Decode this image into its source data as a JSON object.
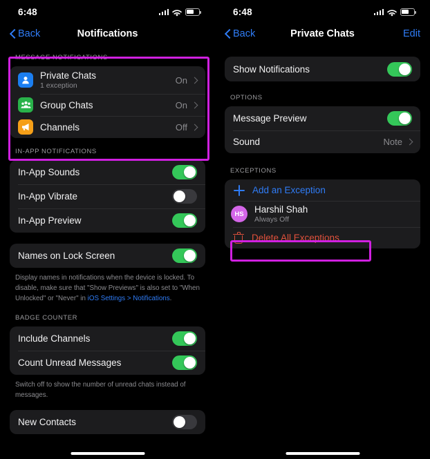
{
  "accent": {
    "blue": "#2f7cf6",
    "green": "#34c759",
    "red": "#e1513c",
    "magenta": "#d020e0",
    "avatar_pink": "#d466e8",
    "card_bg": "#1c1c1e",
    "screen_bg": "#000000"
  },
  "left": {
    "status": {
      "time": "6:48",
      "signal_icon": "cellular-signal-icon",
      "wifi_icon": "wifi-icon",
      "battery_icon": "battery-icon"
    },
    "nav": {
      "back_label": "Back",
      "title": "Notifications",
      "action_label": ""
    },
    "message_notifications": {
      "header": "MESSAGE NOTIFICATIONS",
      "rows": [
        {
          "icon": "private-chats-icon",
          "label": "Private Chats",
          "sub": "1 exception",
          "value": "On"
        },
        {
          "icon": "group-chats-icon",
          "label": "Group Chats",
          "sub": "",
          "value": "On"
        },
        {
          "icon": "channels-icon",
          "label": "Channels",
          "sub": "",
          "value": "Off"
        }
      ]
    },
    "in_app_notifications": {
      "header": "IN-APP NOTIFICATIONS",
      "rows": [
        {
          "label": "In-App Sounds",
          "state": "on"
        },
        {
          "label": "In-App Vibrate",
          "state": "off"
        },
        {
          "label": "In-App Preview",
          "state": "on"
        }
      ]
    },
    "names_lock_screen": {
      "label": "Names on Lock Screen",
      "state": "on",
      "footer_part1": "Display names in notifications when the device is locked. To disable, make sure that \"Show Previews\" is also set to \"When Unlocked\" or \"Never\" in ",
      "footer_link": "iOS Settings > Notifications",
      "footer_part2": "."
    },
    "badge_counter": {
      "header": "BADGE COUNTER",
      "rows": [
        {
          "label": "Include Channels",
          "state": "on"
        },
        {
          "label": "Count Unread Messages",
          "state": "on"
        }
      ],
      "footer": "Switch off to show the number of unread chats instead of messages."
    },
    "new_contacts": {
      "label": "New Contacts",
      "state": "off"
    }
  },
  "right": {
    "status": {
      "time": "6:48",
      "signal_icon": "cellular-signal-icon",
      "wifi_icon": "wifi-icon",
      "battery_icon": "battery-icon"
    },
    "nav": {
      "back_label": "Back",
      "title": "Private Chats",
      "action_label": "Edit"
    },
    "show_notifications": {
      "label": "Show Notifications",
      "state": "on"
    },
    "options": {
      "header": "OPTIONS",
      "rows": [
        {
          "label": "Message Preview",
          "type": "toggle",
          "state": "on",
          "value": ""
        },
        {
          "label": "Sound",
          "type": "value",
          "state": "",
          "value": "Note"
        }
      ]
    },
    "exceptions": {
      "header": "EXCEPTIONS",
      "add_label": "Add an Exception",
      "person": {
        "initials": "HS",
        "name": "Harshil Shah",
        "sub": "Always Off"
      },
      "delete_label": "Delete All Exceptions"
    }
  }
}
